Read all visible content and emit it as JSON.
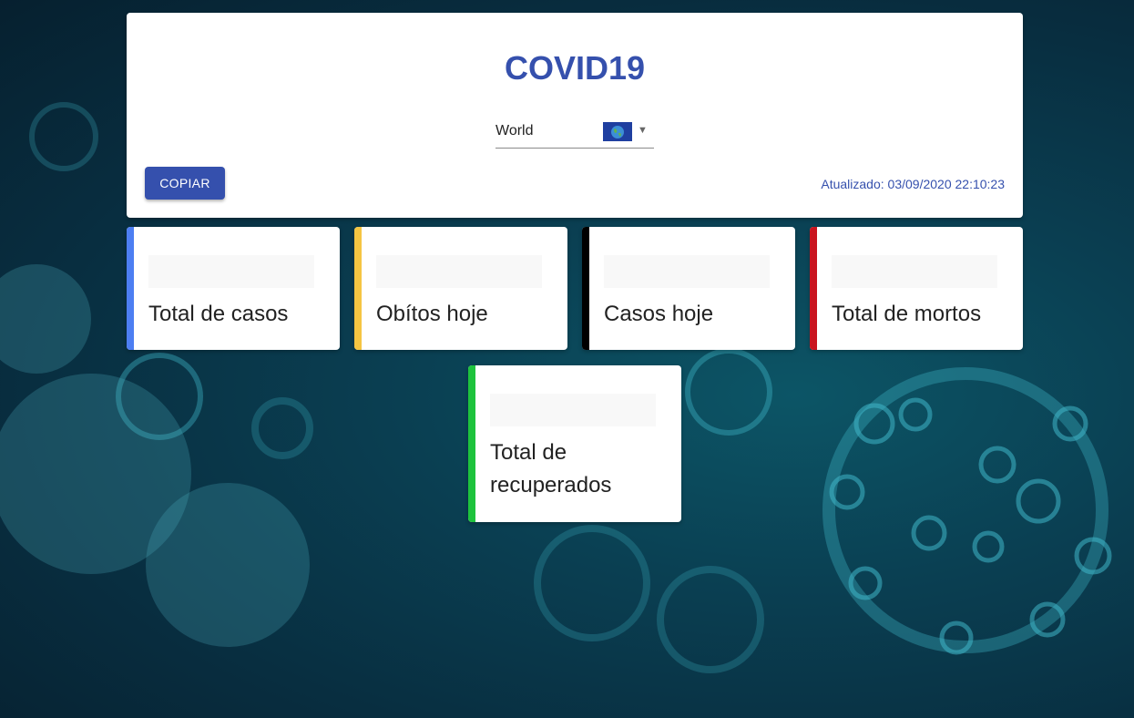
{
  "header": {
    "title": "COVID19",
    "country_select": {
      "value": "World",
      "flag_icon": "globe-icon"
    },
    "copy_button": "COPIAR",
    "updated": "Atualizado: 03/09/2020 22:10:23"
  },
  "stats": [
    {
      "label": "Total de casos",
      "value": "",
      "color": "#4d7ef2"
    },
    {
      "label": "Obítos hoje",
      "value": "",
      "color": "#f5c542"
    },
    {
      "label": "Casos hoje",
      "value": "",
      "color": "#000000"
    },
    {
      "label": "Total de mortos",
      "value": "",
      "color": "#c9141f"
    },
    {
      "label": "Total de recuperados",
      "value": "",
      "color": "#1ec33d"
    }
  ],
  "colors": {
    "primary": "#3550ad"
  }
}
